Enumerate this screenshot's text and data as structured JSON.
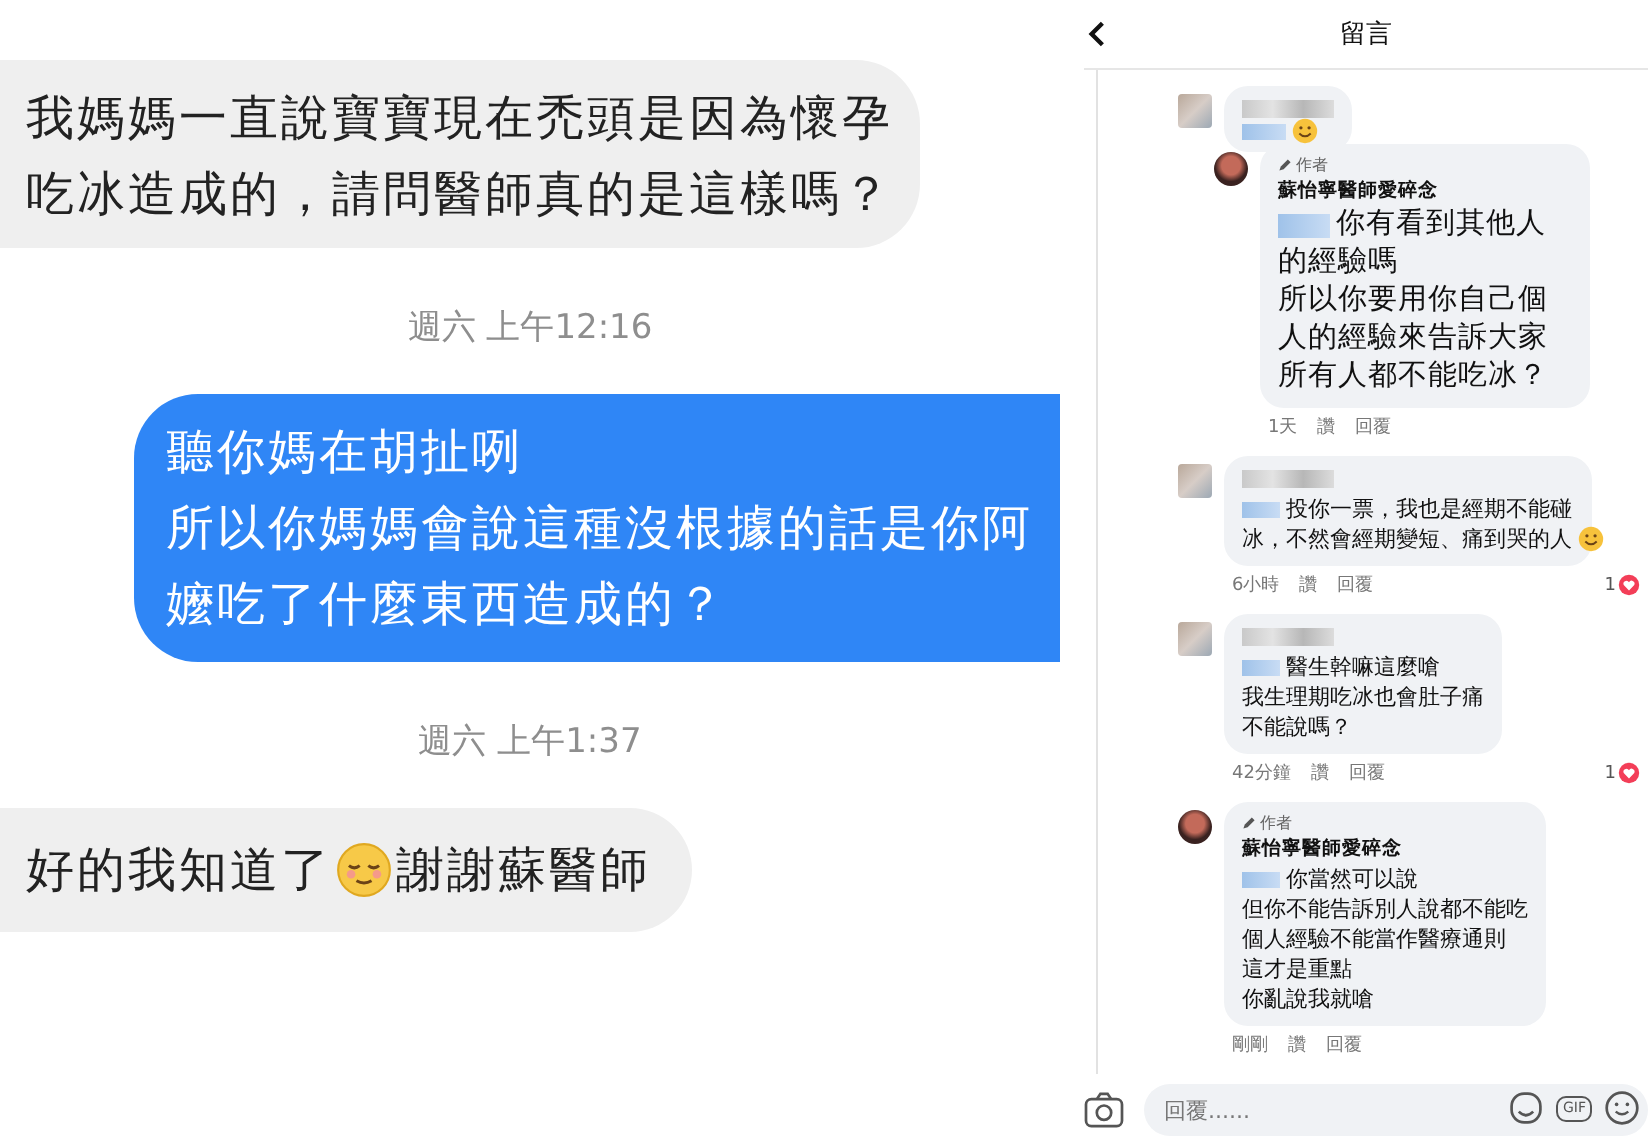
{
  "chat": {
    "messages": [
      {
        "kind": "received",
        "paragraphs": [
          "我媽媽一直說寶寶現在禿頭是因為懷孕吃冰造成的，請問醫師真的是這樣嗎？"
        ]
      },
      {
        "kind": "time",
        "text": "週六 上午12:16"
      },
      {
        "kind": "sent",
        "paragraphs": [
          "聽你媽在胡扯咧",
          "所以你媽媽會說這種沒根據的話是你阿嬤吃了什麼東西造成的？"
        ]
      },
      {
        "kind": "time",
        "text": "週六 上午1:37"
      },
      {
        "kind": "received",
        "text": "好的我知道了",
        "emoji": true,
        "after": "謝謝蘇醫師"
      }
    ]
  },
  "comments_panel": {
    "title": "留言",
    "comments": [
      {
        "kind": "user",
        "emoji": true,
        "children": [
          {
            "kind": "author",
            "badge": "作者",
            "name": "蘇怡寧醫師愛碎念",
            "paragraphs": [
              "你有看到其他人的經驗嗎",
              "所以你要用你自己個人的經驗來告訴大家所有人都不能吃冰？"
            ],
            "emoji": false,
            "time": "1天",
            "like": "讚",
            "reply": "回覆"
          }
        ]
      },
      {
        "kind": "user",
        "paragraphs": [
          "投你一票，我也是經期不能碰冰，不然會經期變短、痛到哭的人"
        ],
        "emoji": true,
        "time": "6小時",
        "like": "讚",
        "reply": "回覆",
        "reactions": "1"
      },
      {
        "kind": "user",
        "paragraphs": [
          "醫生幹嘛這麼嗆",
          "我生理期吃冰也會肚子痛",
          "不能說嗎？"
        ],
        "emoji": false,
        "time": "42分鐘",
        "like": "讚",
        "reply": "回覆",
        "reactions": "1"
      },
      {
        "kind": "author",
        "badge": "作者",
        "name": "蘇怡寧醫師愛碎念",
        "paragraphs": [
          "你當然可以說",
          "但你不能告訴別人說都不能吃",
          "個人經驗不能當作醫療通則",
          "這才是重點",
          "你亂說我就嗆"
        ],
        "emoji": false,
        "time": "剛剛",
        "like": "讚",
        "reply": "回覆"
      }
    ],
    "composer": {
      "placeholder": "回覆......",
      "gif": "GIF"
    }
  }
}
